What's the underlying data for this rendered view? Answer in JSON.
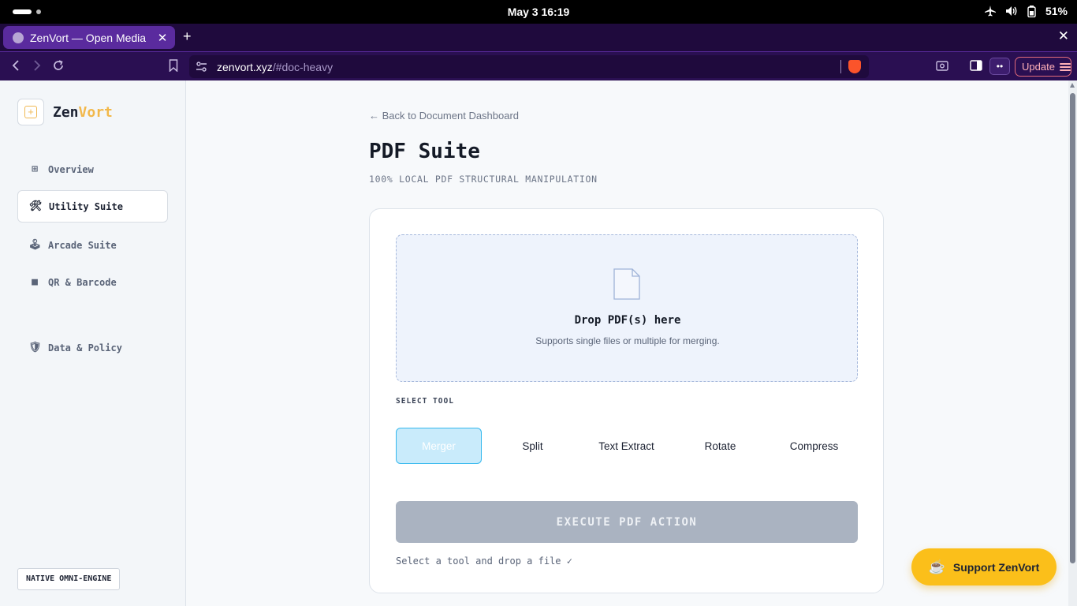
{
  "os": {
    "clock": "May 3  16:19",
    "battery": "51%"
  },
  "browser": {
    "tab_title": "ZenVort — Open Media",
    "url_host": "zenvort.xyz",
    "url_path": "/#doc-heavy",
    "update_label": "Update",
    "ext_label": "••"
  },
  "sidebar": {
    "brand_a": "Zen",
    "brand_b": "Vort",
    "items": [
      {
        "label": "Overview",
        "icon": "⊞"
      },
      {
        "label": "Utility Suite",
        "icon": "🛠"
      },
      {
        "label": "Arcade Suite",
        "icon": "🕹"
      },
      {
        "label": "QR & Barcode",
        "icon": "■"
      },
      {
        "label": "Data & Policy",
        "icon": "🛡"
      }
    ],
    "engine_badge": "NATIVE OMNI-ENGINE"
  },
  "main": {
    "back_link": "← Back to Document Dashboard",
    "title": "PDF Suite",
    "subtitle": "100% LOCAL PDF STRUCTURAL MANIPULATION",
    "drop_title": "Drop PDF(s) here",
    "drop_sub": "Supports single files or multiple for merging.",
    "tool_label": "SELECT TOOL",
    "tools": [
      "Merger",
      "Split",
      "Text Extract",
      "Rotate",
      "Compress"
    ],
    "execute_label": "EXECUTE PDF ACTION",
    "status": "Select a tool and drop a file ✓"
  },
  "support": {
    "label": "Support ZenVort",
    "icon": "☕"
  },
  "colors": {
    "accent": "#f2b84b",
    "browser_chrome": "#2a0f52",
    "tool_active": "#35b8ee",
    "support_bg": "#fbbf1a"
  }
}
